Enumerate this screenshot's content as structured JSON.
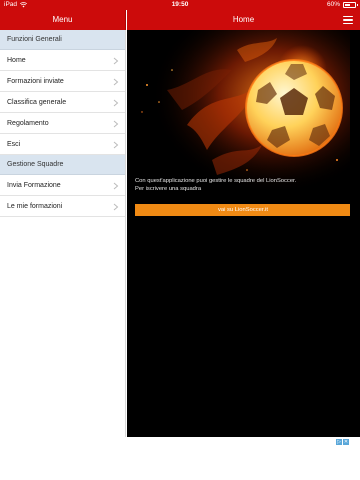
{
  "status_bar": {
    "device": "iPad",
    "time": "19:50",
    "battery": "60%",
    "battery_level": 0.6
  },
  "sidebar": {
    "title": "Menu",
    "sections": [
      {
        "header": "Funzioni Generali",
        "items": [
          {
            "label": "Home"
          },
          {
            "label": "Formazioni inviate"
          },
          {
            "label": "Classifica generale"
          },
          {
            "label": "Regolamento"
          },
          {
            "label": "Esci"
          }
        ]
      },
      {
        "header": "Gestione Squadre",
        "items": [
          {
            "label": "Invia Formazione"
          },
          {
            "label": "Le mie formazioni"
          }
        ]
      }
    ]
  },
  "main": {
    "title": "Home",
    "description_line1": "Con quest'applicazione puoi gestire le squadre del LionSoccer.",
    "description_line2": "Per iscrivere una squadra",
    "cta_label": "vai su LionSoccer.it"
  },
  "colors": {
    "brand_red": "#cc0b0b",
    "cta_orange": "#f08a14",
    "section_header_bg": "#d9e4ef"
  },
  "icons": {
    "menu": "hamburger-icon",
    "chevron": "chevron-right-icon",
    "wifi": "wifi-icon",
    "battery": "battery-icon",
    "ad_choices": "ad-choices-icon"
  }
}
